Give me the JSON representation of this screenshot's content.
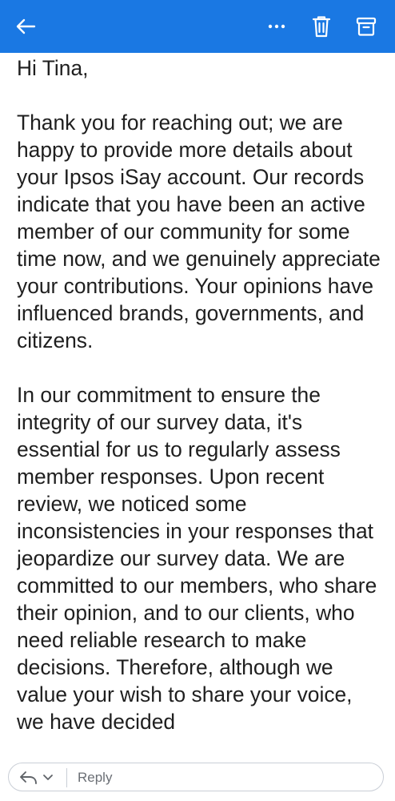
{
  "toolbar": {
    "icons": [
      "back-arrow-icon",
      "more-options-icon",
      "trash-icon",
      "archive-icon"
    ],
    "more_label": "···",
    "color": "#1a78e3"
  },
  "message": {
    "greeting": "Hi Tina,",
    "paragraphs": [
      "Thank you for reaching out; we are happy to provide more details about your Ipsos iSay account. Our records indicate that you have been an active member of our community for some time now, and we genuinely appreciate your contributions. Your opinions have influenced brands, governments, and citizens.",
      "In our commitment to ensure the integrity of our survey data, it's essential for us to regularly assess member responses. Upon recent review, we noticed some inconsistencies in your responses that jeopardize our survey data. We are committed to our members, who share their opinion, and to our clients, who need reliable research to make decisions. Therefore, although we value your wish to share your voice, we have decided"
    ]
  },
  "reply": {
    "placeholder": "Reply",
    "icons": [
      "reply-arrow-icon",
      "chevron-down-icon"
    ]
  }
}
